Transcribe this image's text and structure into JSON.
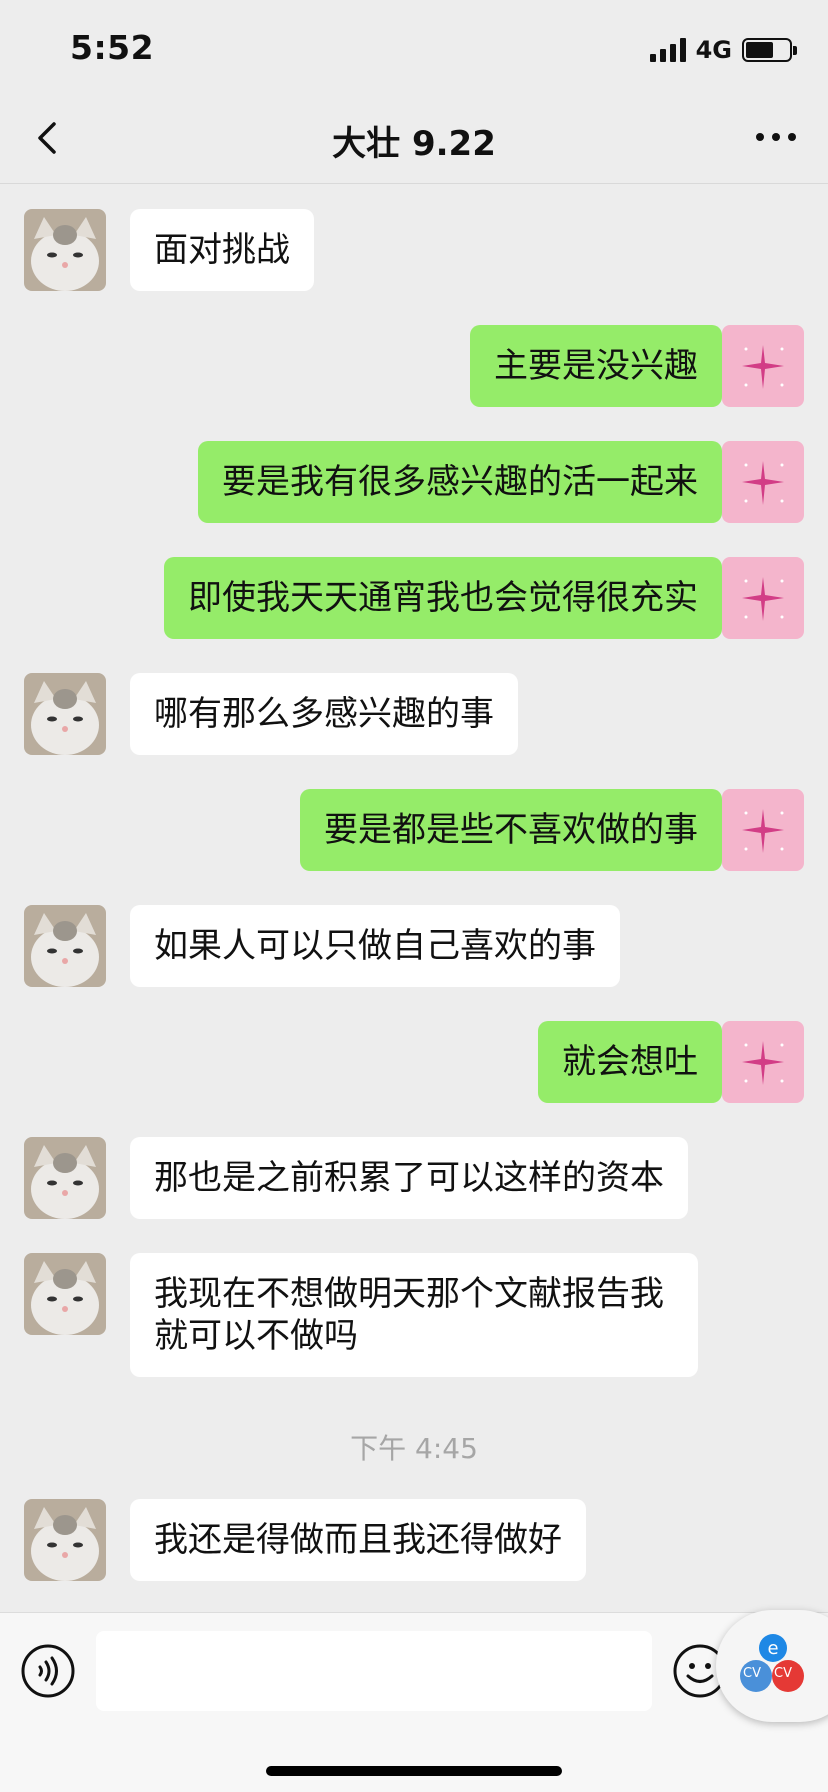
{
  "status_bar": {
    "time": "5:52",
    "network": "4G",
    "battery_level_fraction": 0.65
  },
  "header": {
    "title": "大壮 9.22"
  },
  "messages": [
    {
      "side": "left",
      "text": "面对挑战"
    },
    {
      "side": "right",
      "text": "主要是没兴趣"
    },
    {
      "side": "right",
      "text": "要是我有很多感兴趣的活一起来"
    },
    {
      "side": "right",
      "text": "即使我天天通宵我也会觉得很充实"
    },
    {
      "side": "left",
      "text": "哪有那么多感兴趣的事"
    },
    {
      "side": "right",
      "text": "要是都是些不喜欢做的事"
    },
    {
      "side": "left",
      "text": "如果人可以只做自己喜欢的事"
    },
    {
      "side": "right",
      "text": "就会想吐"
    },
    {
      "side": "left",
      "text": "那也是之前积累了可以这样的资本"
    },
    {
      "side": "left",
      "text": "我现在不想做明天那个文献报告我就可以不做吗"
    },
    {
      "side": "left",
      "text": "我还是得做而且我还得做好"
    }
  ],
  "timestamp": "下午 4:45",
  "input": {
    "value": ""
  },
  "colors": {
    "sent_bubble": "#95ec69",
    "received_bubble": "#ffffff",
    "background": "#ededed"
  },
  "widget_labels": [
    "CV",
    "CV"
  ]
}
